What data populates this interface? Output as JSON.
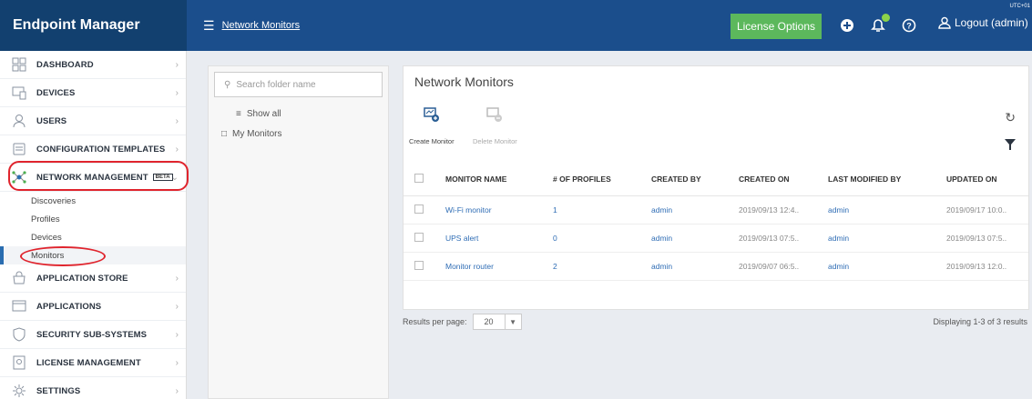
{
  "app": {
    "title": "Endpoint Manager",
    "breadcrumb": "Network Monitors",
    "timezone": "UTC+01"
  },
  "header": {
    "license_button": "License Options",
    "logout": "Logout (admin)"
  },
  "sidebar": {
    "items": [
      {
        "label": "DASHBOARD",
        "icon": "dashboard-icon"
      },
      {
        "label": "DEVICES",
        "icon": "devices-icon"
      },
      {
        "label": "USERS",
        "icon": "users-icon"
      },
      {
        "label": "CONFIGURATION TEMPLATES",
        "icon": "templates-icon"
      },
      {
        "label": "NETWORK MANAGEMENT",
        "icon": "network-icon",
        "badge": "BETA"
      }
    ],
    "sub_items": [
      "Discoveries",
      "Profiles",
      "Devices",
      "Monitors"
    ],
    "items_after": [
      {
        "label": "APPLICATION STORE",
        "icon": "store-icon"
      },
      {
        "label": "APPLICATIONS",
        "icon": "applications-icon"
      },
      {
        "label": "SECURITY SUB-SYSTEMS",
        "icon": "security-icon"
      },
      {
        "label": "LICENSE MANAGEMENT",
        "icon": "license-icon"
      },
      {
        "label": "SETTINGS",
        "icon": "settings-icon"
      }
    ]
  },
  "folders": {
    "search_placeholder": "Search folder name",
    "show_all": "Show all",
    "my_monitors": "My Monitors"
  },
  "main": {
    "title": "Network Monitors",
    "create_label": "Create Monitor",
    "delete_label": "Delete Monitor",
    "columns": [
      "MONITOR NAME",
      "# OF PROFILES",
      "CREATED BY",
      "CREATED ON",
      "LAST MODIFIED BY",
      "UPDATED ON"
    ],
    "rows": [
      [
        "Wi-Fi monitor",
        "1",
        "admin",
        "2019/09/13 12:4..",
        "admin",
        "2019/09/17 10:0.."
      ],
      [
        "UPS alert",
        "0",
        "admin",
        "2019/09/13 07:5..",
        "admin",
        "2019/09/13 07:5.."
      ],
      [
        "Monitor router",
        "2",
        "admin",
        "2019/09/07 06:5..",
        "admin",
        "2019/09/13 12:0.."
      ]
    ]
  },
  "footer": {
    "results_per_page_label": "Results per page:",
    "results_per_page_value": "20",
    "displaying": "Displaying 1-3 of 3 results"
  },
  "colors": {
    "topbar": "#1b4e8c",
    "brand": "#12406f",
    "license": "#5cb85c",
    "highlight": "#e0242d",
    "link": "#2f6db5"
  }
}
